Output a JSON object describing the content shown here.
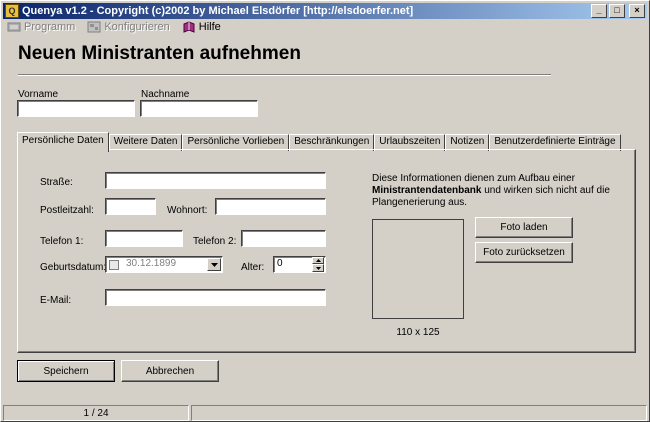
{
  "window": {
    "title": "Quenya v1.2  -  Copyright (c)2002 by Michael Elsdörfer [http://elsdoerfer.net]",
    "minimize_label": "_",
    "maximize_label": "□",
    "close_label": "×"
  },
  "menu": {
    "items": [
      {
        "label": "Programm",
        "icon": "program-icon",
        "enabled": false
      },
      {
        "label": "Konfigurieren",
        "icon": "settings-icon",
        "enabled": false
      },
      {
        "label": "Hilfe",
        "icon": "help-book-icon",
        "enabled": true
      }
    ]
  },
  "form": {
    "heading": "Neuen Ministranten aufnehmen",
    "vorname_label": "Vorname",
    "vorname_value": "",
    "nachname_label": "Nachname",
    "nachname_value": ""
  },
  "tabs": [
    {
      "label": "Persönliche Daten",
      "active": true
    },
    {
      "label": "Weitere Daten",
      "active": false
    },
    {
      "label": "Persönliche Vorlieben",
      "active": false
    },
    {
      "label": "Beschränkungen",
      "active": false
    },
    {
      "label": "Urlaubszeiten",
      "active": false
    },
    {
      "label": "Notizen",
      "active": false
    },
    {
      "label": "Benutzerdefinierte Einträge",
      "active": false
    }
  ],
  "personal": {
    "strasse_label": "Straße:",
    "strasse_value": "",
    "plz_label": "Postleitzahl:",
    "plz_value": "",
    "wohnort_label": "Wohnort:",
    "wohnort_value": "",
    "telefon1_label": "Telefon 1:",
    "telefon1_value": "",
    "telefon2_label": "Telefon 2:",
    "telefon2_value": "",
    "geburtsdatum_label": "Geburtsdatum:",
    "geburtsdatum_value": "30.12.1899",
    "geburtsdatum_checked": false,
    "alter_label": "Alter:",
    "alter_value": "0",
    "email_label": "E-Mail:",
    "email_value": ""
  },
  "info": {
    "text_before": "Diese Informationen dienen zum Aufbau einer",
    "text_bold": "Ministrantendatenbank",
    "text_after": "und wirken sich nicht auf die Plangenerierung aus."
  },
  "photo": {
    "caption": "110 x 125",
    "load_label": "Foto laden",
    "reset_label": "Foto zurücksetzen"
  },
  "actions": {
    "save_label": "Speichern",
    "cancel_label": "Abbrechen"
  },
  "status": {
    "record_position": "1 / 24"
  }
}
